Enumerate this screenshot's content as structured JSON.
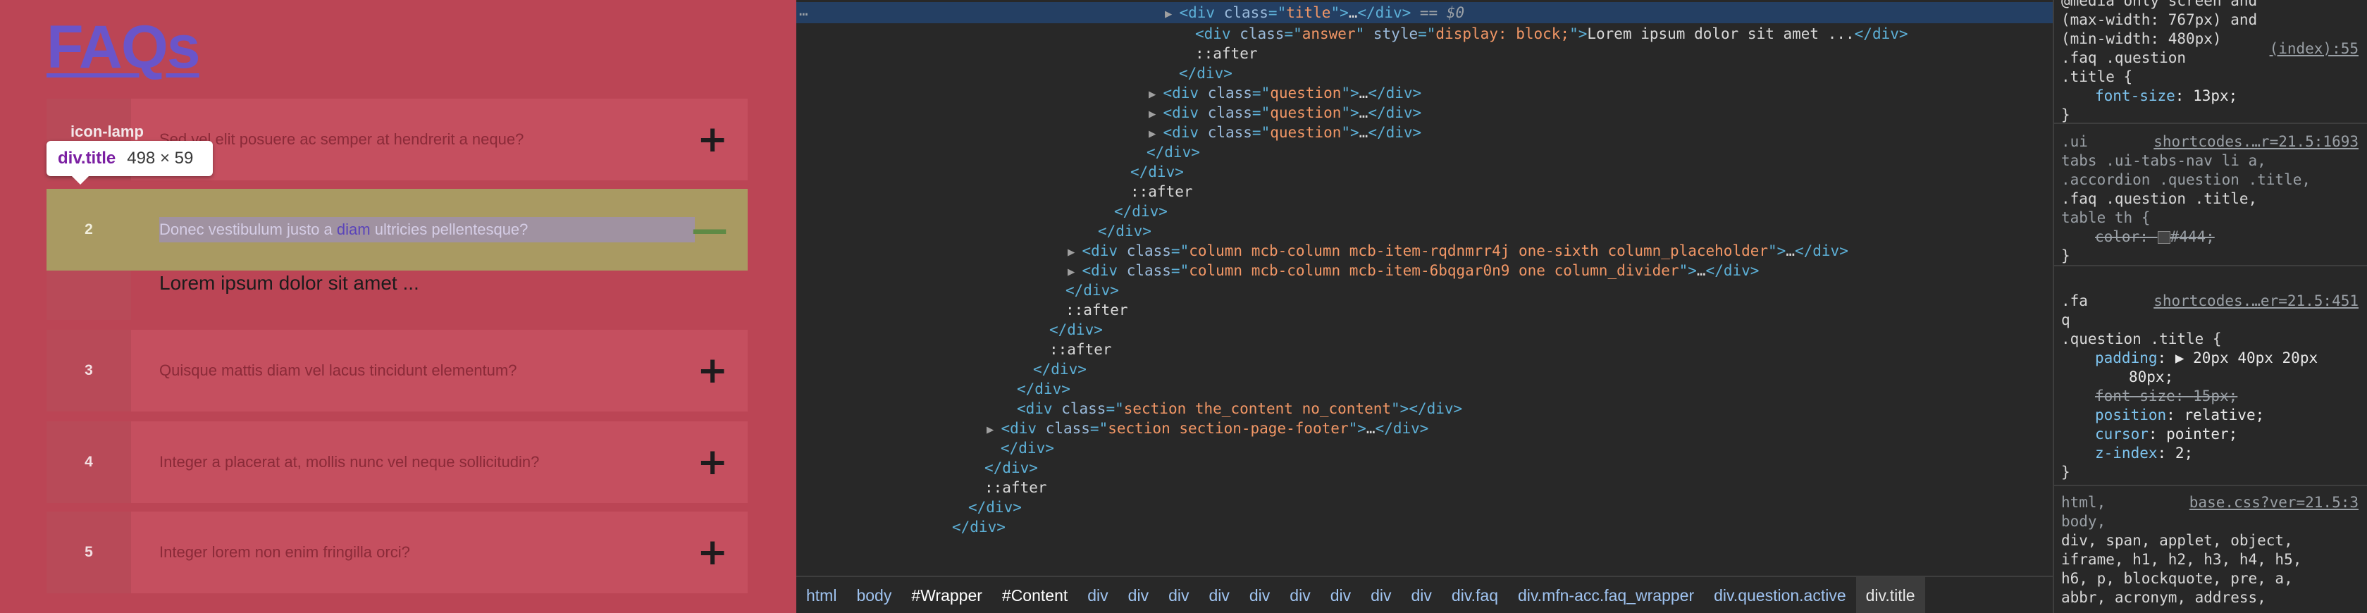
{
  "page": {
    "title": "FAQs",
    "icon_lamp_label": "icon-lamp",
    "tooltip": {
      "selector": "div.title",
      "dims": "498 × 59"
    },
    "faqs": [
      {
        "num": "",
        "question": "Sed vel elit posuere ac semper at hendrerit a neque?",
        "toggle": "+"
      },
      {
        "num": "2",
        "question_pre": "Donec vestibulum justo a ",
        "question_mid": "diam",
        "question_post": " ultricies pellentesque?",
        "toggle": "—"
      },
      {
        "num": "3",
        "question": "Quisque mattis diam vel lacus tincidunt elementum?",
        "toggle": "+"
      },
      {
        "num": "4",
        "question": "Integer a placerat at, mollis nunc vel neque sollicitudin?",
        "toggle": "+"
      },
      {
        "num": "5",
        "question": "Integer lorem non enim fringilla orci?",
        "toggle": "+"
      }
    ],
    "answer": "Lorem ipsum dolor sit amet ..."
  },
  "elements": {
    "ellipsis": "…",
    "lines": [
      {
        "indent": 21,
        "tri": "▶",
        "html": [
          [
            "t",
            "<div "
          ],
          [
            "an",
            "class"
          ],
          [
            "t",
            "=\""
          ],
          [
            "av",
            "title"
          ],
          [
            "t",
            "\">"
          ],
          [
            "tx",
            "…"
          ],
          [
            "t",
            "</div>"
          ],
          [
            "eq",
            " == $0"
          ]
        ]
      },
      {
        "indent": 22,
        "html": [
          [
            "t",
            "<div "
          ],
          [
            "an",
            "class"
          ],
          [
            "t",
            "=\""
          ],
          [
            "av",
            "answer"
          ],
          [
            "t",
            "\" "
          ],
          [
            "an",
            "style"
          ],
          [
            "t",
            "=\""
          ],
          [
            "av",
            "display: block;"
          ],
          [
            "t",
            "\">"
          ],
          [
            "tx",
            "Lorem ipsum dolor sit amet ..."
          ],
          [
            "t",
            "</div>"
          ]
        ]
      },
      {
        "indent": 22,
        "html": [
          [
            "ps",
            "::after"
          ]
        ]
      },
      {
        "indent": 21,
        "html": [
          [
            "t",
            "</div>"
          ]
        ]
      },
      {
        "indent": 20,
        "tri": "▶",
        "html": [
          [
            "t",
            "<div "
          ],
          [
            "an",
            "class"
          ],
          [
            "t",
            "=\""
          ],
          [
            "av",
            "question"
          ],
          [
            "t",
            "\">"
          ],
          [
            "tx",
            "…"
          ],
          [
            "t",
            "</div>"
          ]
        ]
      },
      {
        "indent": 20,
        "tri": "▶",
        "html": [
          [
            "t",
            "<div "
          ],
          [
            "an",
            "class"
          ],
          [
            "t",
            "=\""
          ],
          [
            "av",
            "question"
          ],
          [
            "t",
            "\">"
          ],
          [
            "tx",
            "…"
          ],
          [
            "t",
            "</div>"
          ]
        ]
      },
      {
        "indent": 20,
        "tri": "▶",
        "html": [
          [
            "t",
            "<div "
          ],
          [
            "an",
            "class"
          ],
          [
            "t",
            "=\""
          ],
          [
            "av",
            "question"
          ],
          [
            "t",
            "\">"
          ],
          [
            "tx",
            "…"
          ],
          [
            "t",
            "</div>"
          ]
        ]
      },
      {
        "indent": 19,
        "html": [
          [
            "t",
            "</div>"
          ]
        ]
      },
      {
        "indent": 18,
        "html": [
          [
            "t",
            "</div>"
          ]
        ]
      },
      {
        "indent": 18,
        "html": [
          [
            "ps",
            "::after"
          ]
        ]
      },
      {
        "indent": 17,
        "html": [
          [
            "t",
            "</div>"
          ]
        ]
      },
      {
        "indent": 16,
        "html": [
          [
            "t",
            "</div>"
          ]
        ]
      },
      {
        "indent": 15,
        "tri": "▶",
        "html": [
          [
            "t",
            "<div "
          ],
          [
            "an",
            "class"
          ],
          [
            "t",
            "=\""
          ],
          [
            "av",
            "column mcb-column mcb-item-rqdnmrr4j one-sixth column_placeholder"
          ],
          [
            "t",
            "\">"
          ],
          [
            "tx",
            "…"
          ],
          [
            "t",
            "</div>"
          ]
        ]
      },
      {
        "indent": 15,
        "tri": "▶",
        "html": [
          [
            "t",
            "<div "
          ],
          [
            "an",
            "class"
          ],
          [
            "t",
            "=\""
          ],
          [
            "av",
            "column mcb-column mcb-item-6bqgar0n9 one column_divider"
          ],
          [
            "t",
            "\">"
          ],
          [
            "tx",
            "…"
          ],
          [
            "t",
            "</div>"
          ]
        ]
      },
      {
        "indent": 14,
        "html": [
          [
            "t",
            "</div>"
          ]
        ]
      },
      {
        "indent": 14,
        "html": [
          [
            "ps",
            "::after"
          ]
        ]
      },
      {
        "indent": 13,
        "html": [
          [
            "t",
            "</div>"
          ]
        ]
      },
      {
        "indent": 13,
        "html": [
          [
            "ps",
            "::after"
          ]
        ]
      },
      {
        "indent": 12,
        "html": [
          [
            "t",
            "</div>"
          ]
        ]
      },
      {
        "indent": 11,
        "html": [
          [
            "t",
            "</div>"
          ]
        ]
      },
      {
        "indent": 11,
        "html": [
          [
            "t",
            "<div "
          ],
          [
            "an",
            "class"
          ],
          [
            "t",
            "=\""
          ],
          [
            "av",
            "section the_content no_content"
          ],
          [
            "t",
            "\">"
          ],
          [
            "t",
            "</div>"
          ]
        ]
      },
      {
        "indent": 10,
        "tri": "▶",
        "html": [
          [
            "t",
            "<div "
          ],
          [
            "an",
            "class"
          ],
          [
            "t",
            "=\""
          ],
          [
            "av",
            "section section-page-footer"
          ],
          [
            "t",
            "\">"
          ],
          [
            "tx",
            "…"
          ],
          [
            "t",
            "</div>"
          ]
        ]
      },
      {
        "indent": 10,
        "html": [
          [
            "t",
            "</div>"
          ]
        ]
      },
      {
        "indent": 9,
        "html": [
          [
            "t",
            "</div>"
          ]
        ]
      },
      {
        "indent": 9,
        "html": [
          [
            "ps",
            "::after"
          ]
        ]
      },
      {
        "indent": 8,
        "html": [
          [
            "t",
            "</div>"
          ]
        ]
      },
      {
        "indent": 7,
        "html": [
          [
            "t",
            "</div>"
          ]
        ]
      }
    ],
    "breadcrumbs": [
      "html",
      "body",
      "#Wrapper",
      "#Content",
      "div",
      "div",
      "div",
      "div",
      "div",
      "div",
      "div",
      "div",
      "div",
      "div.faq",
      "div.mfn-acc.faq_wrapper",
      "div.question.active",
      "div.title"
    ]
  },
  "styles": {
    "rule1": {
      "media": "@media only screen and (max-width: 767px) and (min-width: 480px)",
      "selector1": ".faq .question",
      "selector2": ".title {",
      "source": "(index):55",
      "prop": "font-size",
      "value": "13px;",
      "close": "}"
    },
    "rule2": {
      "selector_dim1": ".ui",
      "selector_dim2": "tabs .ui-tabs-nav li a,",
      "selector_dim3": ".accordion .question .title,",
      "selector_main": ".faq .question .title,",
      "selector_dim4": "table th {",
      "source": "shortcodes.…r=21.5:1693",
      "prop": "color",
      "value": "#444;",
      "swatch_color": "#444444",
      "close": "}"
    },
    "rule3": {
      "selector1": ".fa",
      "selector2": "q",
      "selector3": ".question .title {",
      "source": "shortcodes.…er=21.5:451",
      "props": [
        {
          "name": "padding",
          "value": "▶ 20px 40px 20px",
          "value2": "80px;",
          "strike": false
        },
        {
          "name": "font-size",
          "value": "15px;",
          "strike": true
        },
        {
          "name": "position",
          "value": "relative;",
          "strike": false
        },
        {
          "name": "cursor",
          "value": "pointer;",
          "strike": false
        },
        {
          "name": "z-index",
          "value": "2;",
          "strike": false
        }
      ],
      "close": "}"
    },
    "rule4": {
      "selector": "html,",
      "source": "base.css?ver=21.5:3",
      "list1": "body,",
      "list2": "div, span, applet, object,",
      "list3": "iframe, h1, h2, h3, h4, h5,",
      "list4": "h6, p, blockquote, pre, a,",
      "list5": "abbr, acronym, address,"
    }
  }
}
